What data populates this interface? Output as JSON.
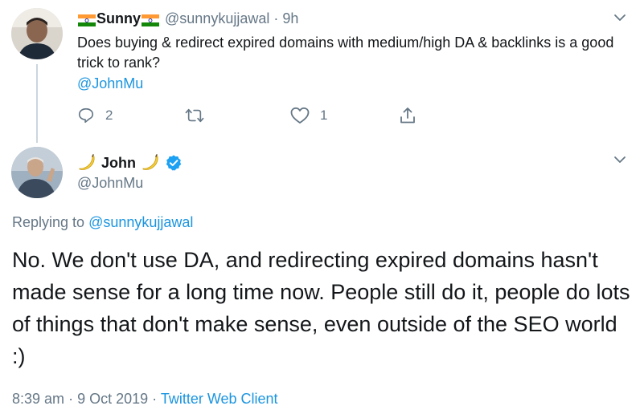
{
  "reply_tweet": {
    "display_name": "Sunny",
    "handle": "@sunnykujjawal",
    "separator": "·",
    "time": "9h",
    "text": "Does buying & redirect expired domains with medium/high DA & backlinks is a good trick to rank?",
    "mention": "@JohnMu",
    "actions": {
      "reply_count": "2",
      "retweet_count": "",
      "like_count": "1"
    },
    "icons": [
      "india-flag-icon",
      "chevron-down-icon",
      "reply-icon",
      "retweet-icon",
      "heart-icon",
      "share-icon"
    ]
  },
  "main_tweet": {
    "display_name": "John",
    "handle": "@JohnMu",
    "replying_to_label": "Replying to",
    "replying_to_handle": "@sunnykujjawal",
    "text": "No. We don't use DA, and redirecting expired domains hasn't made sense for a long time now. People still do it, people do lots of things that don't make sense, even outside of the SEO world :)",
    "time": "8:39 am",
    "date": "9 Oct 2019",
    "meta_separator": "·",
    "client": "Twitter Web Client",
    "icons": [
      "banana-icon",
      "verified-badge-icon",
      "chevron-down-icon"
    ]
  },
  "colors": {
    "link": "#1b95e0",
    "secondary_text": "#657786",
    "primary_text": "#14171a",
    "verified": "#1da1f2",
    "thread_line": "#ccd6dd"
  }
}
